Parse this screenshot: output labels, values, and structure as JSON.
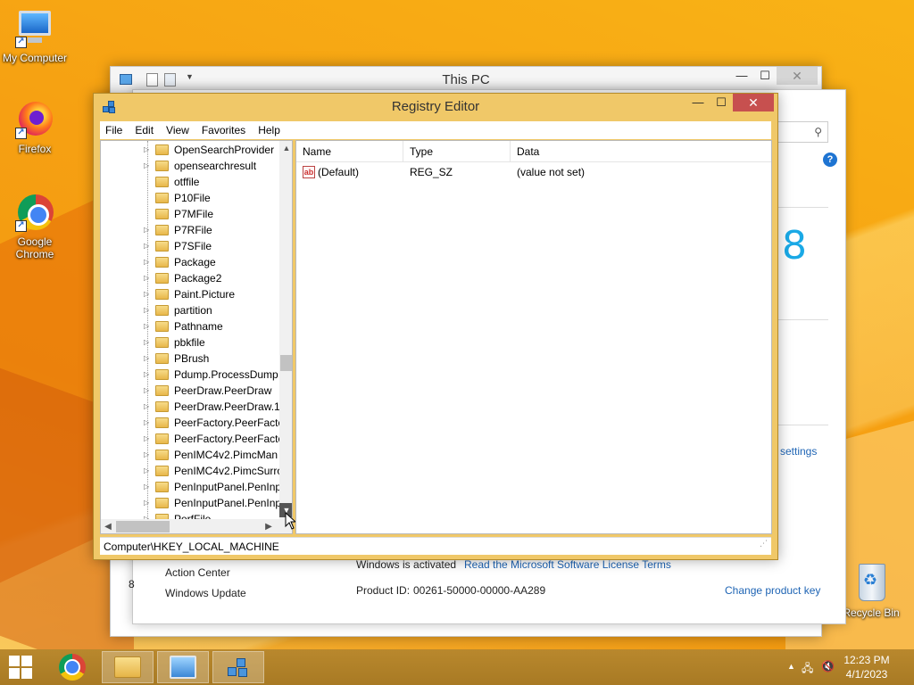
{
  "desktop": {
    "icons": [
      {
        "label": "My Computer"
      },
      {
        "label": "Firefox"
      },
      {
        "label": "Google Chrome"
      },
      {
        "label": "Recycle Bin"
      }
    ]
  },
  "this_pc": {
    "title": "This PC",
    "big_number": "8",
    "settings_link": "settings",
    "left_links": [
      "Action Center",
      "Windows Update"
    ],
    "activation_status": "Windows is activated",
    "license_link": "Read the Microsoft Software License Terms",
    "product_id_label": "Product ID:",
    "product_id": "00261-50000-00000-AA289",
    "change_key_link": "Change product key",
    "partial_char": "8"
  },
  "regedit": {
    "title": "Registry Editor",
    "menu": [
      "File",
      "Edit",
      "View",
      "Favorites",
      "Help"
    ],
    "tree_items": [
      "OpenSearchProvider",
      "opensearchresult",
      "otffile",
      "P10File",
      "P7MFile",
      "P7RFile",
      "P7SFile",
      "Package",
      "Package2",
      "Paint.Picture",
      "partition",
      "Pathname",
      "pbkfile",
      "PBrush",
      "Pdump.ProcessDump",
      "PeerDraw.PeerDraw",
      "PeerDraw.PeerDraw.1",
      "PeerFactory.PeerFacto",
      "PeerFactory.PeerFacto",
      "PenIMC4v2.PimcMan",
      "PenIMC4v2.PimcSurro",
      "PenInputPanel.PenInp",
      "PenInputPanel.PenInp",
      "PerfFile"
    ],
    "tree_expandable": [
      true,
      true,
      false,
      false,
      false,
      true,
      true,
      true,
      true,
      true,
      true,
      true,
      true,
      true,
      true,
      true,
      true,
      true,
      true,
      true,
      true,
      true,
      true,
      true
    ],
    "columns": [
      "Name",
      "Type",
      "Data"
    ],
    "values": [
      {
        "name": "(Default)",
        "type": "REG_SZ",
        "data": "(value not set)"
      }
    ],
    "status_path": "Computer\\HKEY_LOCAL_MACHINE"
  },
  "taskbar": {
    "time": "12:23 PM",
    "date": "4/1/2023"
  },
  "colors": {
    "accent_close": "#c7504f",
    "window_frame": "#f0c868",
    "link": "#1e64b4"
  }
}
